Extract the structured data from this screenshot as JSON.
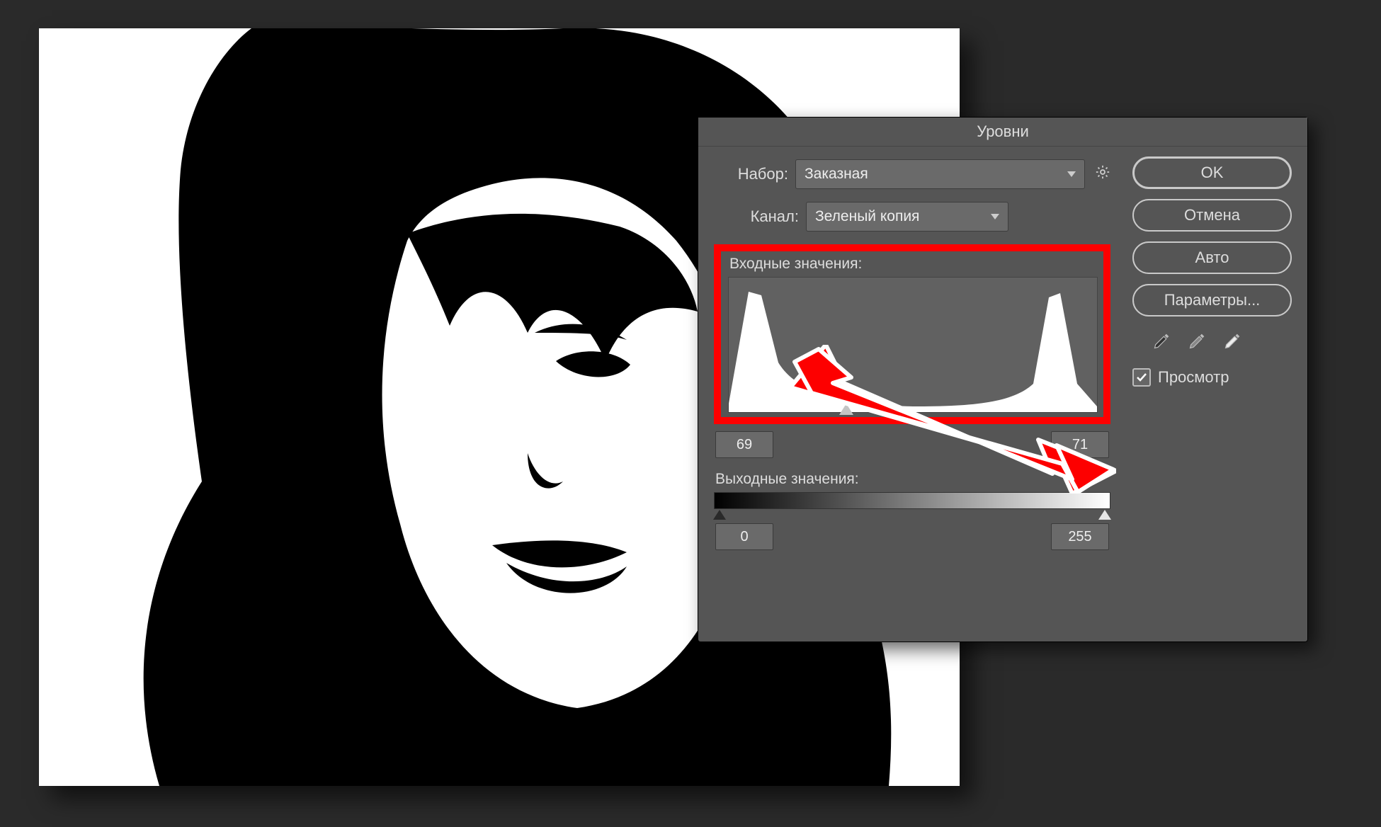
{
  "dialog": {
    "title": "Уровни",
    "preset_label": "Набор:",
    "preset_value": "Заказная",
    "channel_label": "Канал:",
    "channel_value": "Зеленый копия",
    "input_section": "Входные значения:",
    "output_section": "Выходные значения:",
    "input_black": "69",
    "input_white": "71",
    "output_black": "0",
    "output_white": "255",
    "buttons": {
      "ok": "OK",
      "cancel": "Отмена",
      "auto": "Авто",
      "options": "Параметры..."
    },
    "preview_label": "Просмотр",
    "preview_checked": true
  }
}
